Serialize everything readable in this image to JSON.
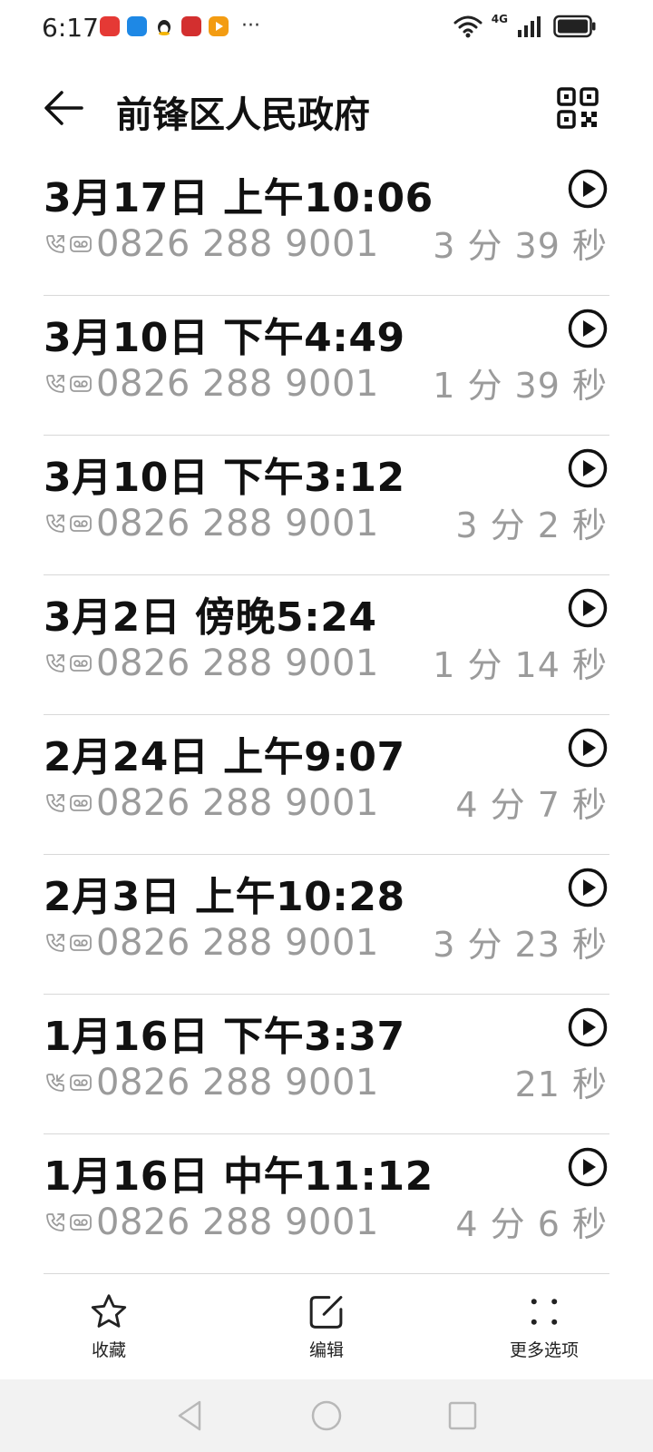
{
  "status_bar": {
    "time": "6:17",
    "more": "···",
    "network": "4G",
    "apps": [
      {
        "icon": "red-app-icon",
        "color": "#e53935"
      },
      {
        "icon": "blue-puzzle-app-icon",
        "color": "#1e88e5"
      },
      {
        "icon": "qq-penguin-icon",
        "color": "#222222"
      },
      {
        "icon": "red-book-app-icon",
        "color": "#d32f2f"
      },
      {
        "icon": "orange-play-app-icon",
        "color": "#f39c12"
      }
    ]
  },
  "header": {
    "title": "前锋区人民政府"
  },
  "calls": [
    {
      "datetime": "3月17日 上午10:06",
      "number": "0826 288 9001",
      "duration": "3 分 39 秒",
      "direction": "outgoing"
    },
    {
      "datetime": "3月10日 下午4:49",
      "number": "0826 288 9001",
      "duration": "1 分 39 秒",
      "direction": "outgoing"
    },
    {
      "datetime": "3月10日 下午3:12",
      "number": "0826 288 9001",
      "duration": "3 分 2 秒",
      "direction": "outgoing"
    },
    {
      "datetime": "3月2日 傍晚5:24",
      "number": "0826 288 9001",
      "duration": "1 分 14 秒",
      "direction": "outgoing"
    },
    {
      "datetime": "2月24日 上午9:07",
      "number": "0826 288 9001",
      "duration": "4 分 7 秒",
      "direction": "outgoing"
    },
    {
      "datetime": "2月3日 上午10:28",
      "number": "0826 288 9001",
      "duration": "3 分 23 秒",
      "direction": "outgoing"
    },
    {
      "datetime": "1月16日 下午3:37",
      "number": "0826 288 9001",
      "duration": "21 秒",
      "direction": "incoming"
    },
    {
      "datetime": "1月16日 中午11:12",
      "number": "0826 288 9001",
      "duration": "4 分 6 秒",
      "direction": "outgoing"
    }
  ],
  "toolbar": {
    "favorite_label": "收藏",
    "edit_label": "编辑",
    "more_label": "更多选项"
  },
  "colors": {
    "text_primary": "#111111",
    "text_secondary": "#9b9b9b",
    "divider": "#d8d8d8",
    "nav_bg": "#f2f2f2"
  }
}
